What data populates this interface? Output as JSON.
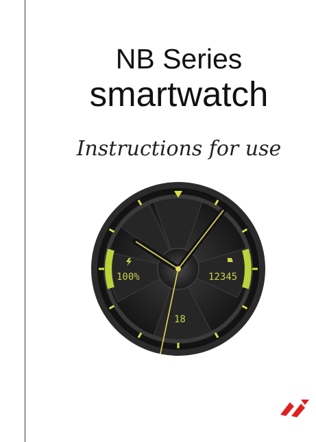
{
  "cover": {
    "title_line1": "NB Series",
    "title_line2": "smartwatch",
    "subtitle": "Instructions for use"
  },
  "watch_face": {
    "battery_text": "100%",
    "steps_text": "12345",
    "date_text": "18",
    "battery_icon": "lightning-icon",
    "steps_icon": "shoe-icon"
  },
  "colors": {
    "accent": "#c7d34c",
    "bezel": "#2b2b2b",
    "face": "#1b1b1b",
    "logo": "#e02020"
  }
}
